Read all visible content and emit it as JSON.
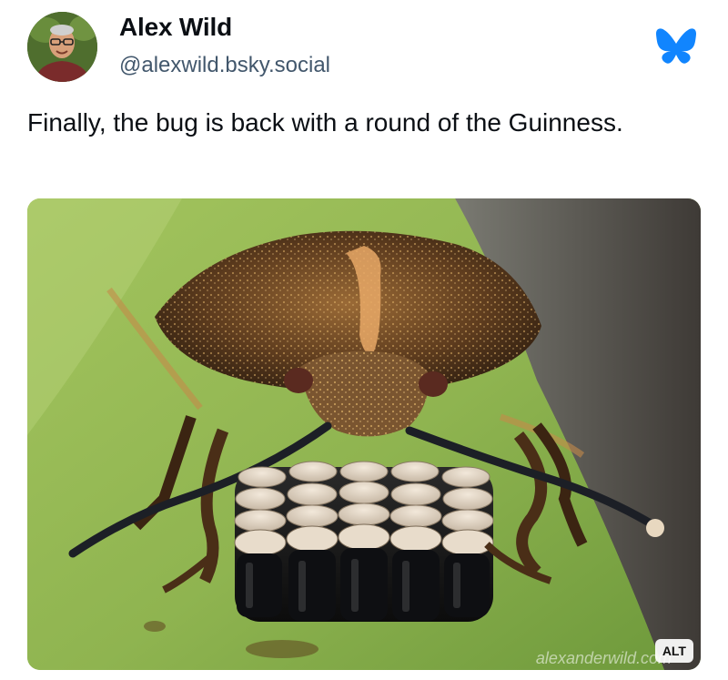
{
  "author": {
    "name": "Alex Wild",
    "handle": "@alexwild.bsky.social",
    "avatar_icon": "avatar-photo"
  },
  "post": {
    "text": "Finally, the bug is back with a round of the Guinness."
  },
  "media": {
    "watermark": "alexanderwild.com",
    "alt_label": "ALT"
  },
  "brand": {
    "icon": "bluesky-butterfly-icon",
    "color": "#1185fe"
  }
}
